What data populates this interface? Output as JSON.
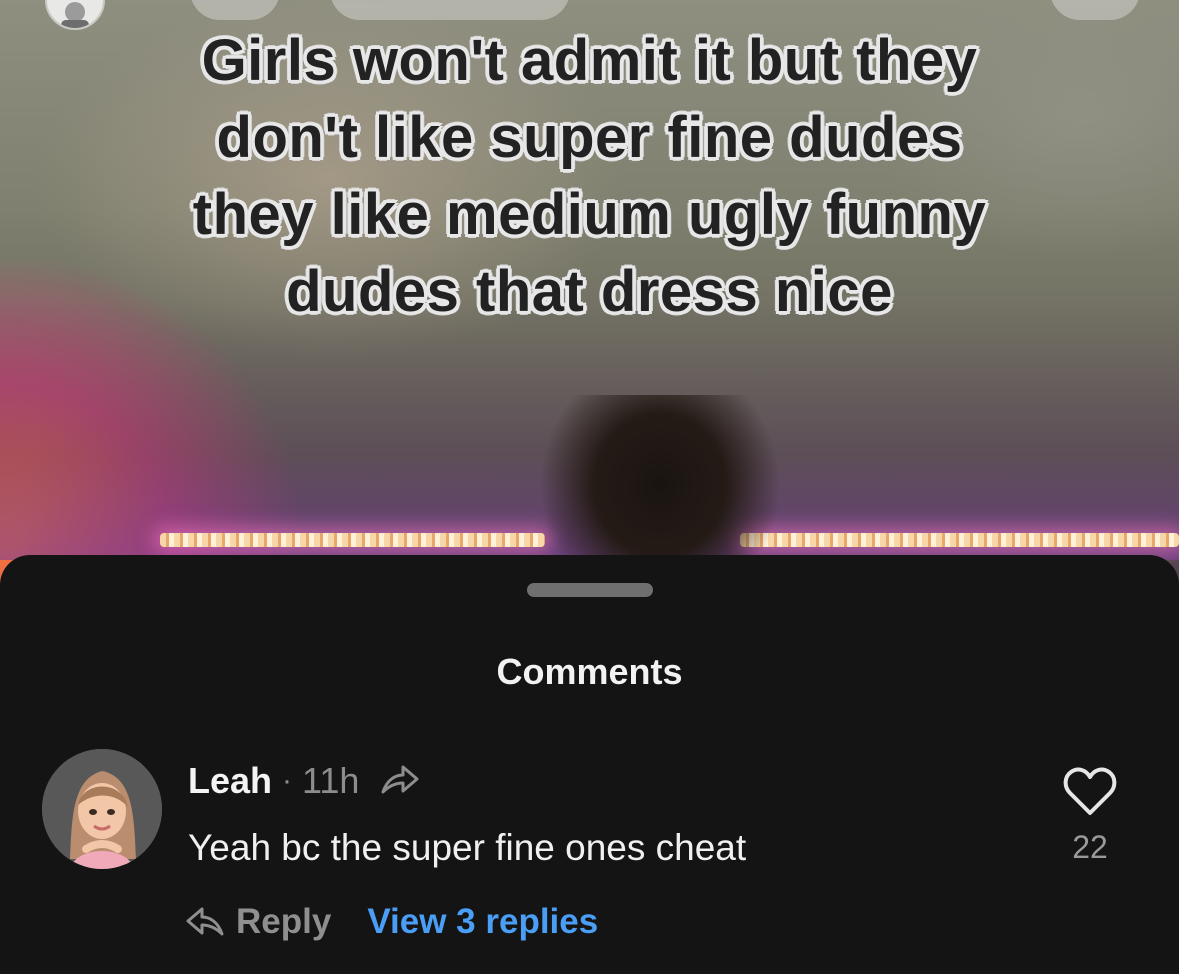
{
  "video": {
    "caption_lines": [
      "Girls won't admit it but they",
      "don't like super fine dudes",
      "they like medium ugly funny",
      "dudes that dress nice"
    ]
  },
  "comments_sheet": {
    "title": "Comments",
    "comment": {
      "username": "Leah",
      "separator": "·",
      "time": "11h",
      "text": "Yeah bc the super fine ones cheat",
      "like_count": "22",
      "reply_label": "Reply",
      "view_replies_label": "View 3 replies"
    }
  },
  "icons": {
    "share": "share-arrow-icon",
    "like": "heart-outline-icon",
    "reply": "reply-arrow-icon"
  },
  "colors": {
    "sheet_background": "#141414",
    "link_blue": "#4a9ef5",
    "muted_text": "#8d8d8d"
  }
}
